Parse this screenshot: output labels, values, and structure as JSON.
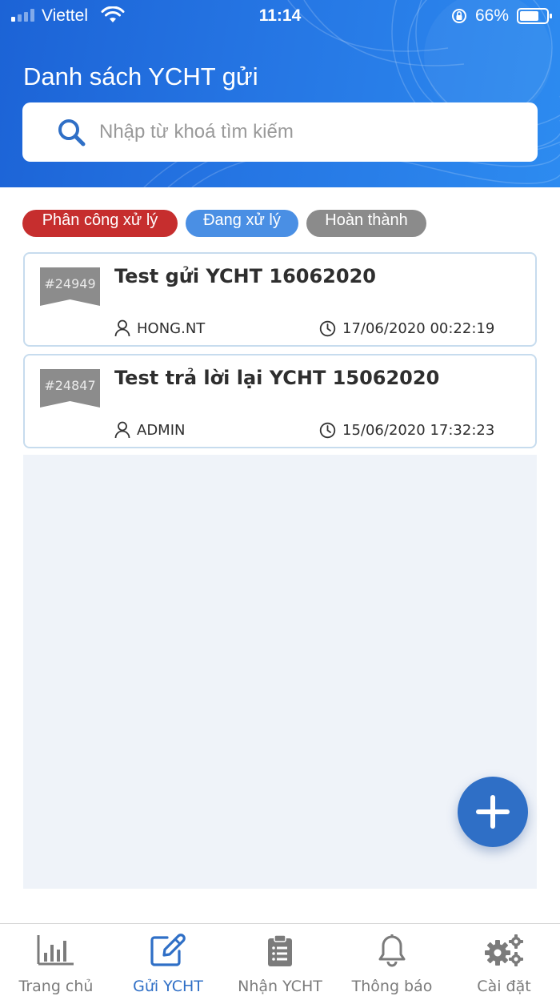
{
  "status_bar": {
    "carrier": "Viettel",
    "time": "11:14",
    "battery": "66%"
  },
  "header": {
    "title": "Danh sách YCHT gửi"
  },
  "search": {
    "placeholder": "Nhập từ khoá tìm kiếm"
  },
  "filters": [
    {
      "label": "Phân công xử lý",
      "color": "#c62e2e"
    },
    {
      "label": "Đang xử lý",
      "color": "#4a8fe4"
    },
    {
      "label": "Hoàn thành",
      "color": "#8b8b8b"
    }
  ],
  "requests": [
    {
      "id": "#24949",
      "title": "Test gửi YCHT 16062020",
      "user": "HONG.NT",
      "time": "17/06/2020 00:22:19"
    },
    {
      "id": "#24847",
      "title": "Test trả lời lại YCHT 15062020",
      "user": "ADMIN",
      "time": "15/06/2020 17:32:23"
    }
  ],
  "fab": {
    "icon": "plus-icon"
  },
  "nav": [
    {
      "label": "Trang chủ",
      "icon": "bar-chart-icon",
      "active": false
    },
    {
      "label": "Gửi YCHT",
      "icon": "edit-icon",
      "active": true
    },
    {
      "label": "Nhận YCHT",
      "icon": "clipboard-icon",
      "active": false
    },
    {
      "label": "Thông báo",
      "icon": "bell-icon",
      "active": false
    },
    {
      "label": "Cài đặt",
      "icon": "gears-icon",
      "active": false
    }
  ],
  "colors": {
    "brand": "#2f6fc6",
    "header_gradient": [
      "#1c63d6",
      "#2d8bf0"
    ],
    "list_background": "#eff3f9"
  }
}
